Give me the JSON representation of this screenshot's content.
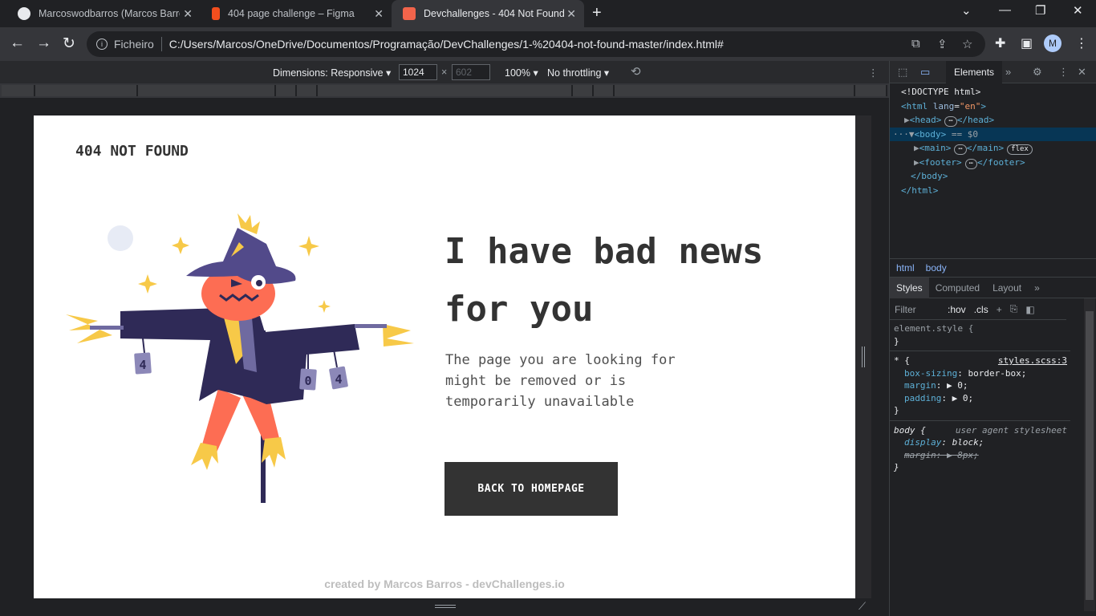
{
  "browser": {
    "tabs": [
      {
        "title": "Marcoswodbarros (Marcos Barros)",
        "color": "#e8eaed"
      },
      {
        "title": "404 page challenge – Figma",
        "color": "#f24e1e"
      },
      {
        "title": "Devchallenges - 404 Not Found",
        "color": "#f2644b"
      }
    ],
    "scheme": "Ficheiro",
    "url": "C:/Users/Marcos/OneDrive/Documentos/Programação/DevChallenges/1-%20404-not-found-master/index.html#",
    "avatar": "M"
  },
  "devicebar": {
    "dimensions": "Dimensions: Responsive ▾",
    "width": "1024",
    "height": "602",
    "zoom": "100% ▾",
    "throttling": "No throttling ▾"
  },
  "page": {
    "brand": "404 NOT FOUND",
    "headline": "I have bad news for you",
    "description": "The page you are looking for might be removed or is temporarily unavailable",
    "button": "BACK TO HOMEPAGE",
    "footer": "created by Marcos Barros - devChallenges.io",
    "cans": [
      "4",
      "0",
      "4"
    ]
  },
  "devtools": {
    "tab": "Elements",
    "dom": {
      "doctype": "<!DOCTYPE html>",
      "html_open": "<html",
      "html_attr": "lang",
      "html_val": "\"en\"",
      "head": "<head>",
      "head_close": "</head>",
      "body": "<body>",
      "body_note": "== $0",
      "main": "<main>",
      "main_close": "</main>",
      "flex": "flex",
      "footer": "<footer>",
      "footer_close": "</footer>",
      "body_close": "</body>",
      "html_close": "</html>",
      "ellipsis": "⋯"
    },
    "breadcrumbs": [
      "html",
      "body"
    ],
    "style_tabs": [
      "Styles",
      "Computed",
      "Layout"
    ],
    "filter": "Filter",
    "hov": ":hov",
    "cls": ".cls",
    "rules": {
      "element_style": "element.style {",
      "close": "}",
      "universal": "* {",
      "source": "styles.scss:3",
      "p1": "box-sizing",
      "v1": "border-box;",
      "p2": "margin",
      "v2": "▶ 0;",
      "p3": "padding",
      "v3": "▶ 0;",
      "body_sel": "body {",
      "ua": "user agent stylesheet",
      "p4": "display",
      "v4": "block;",
      "p5": "margin",
      "v5": "▶ 8px;"
    }
  },
  "colors": {
    "accent": "#333333",
    "scarecrow_hat": "#524a8a",
    "scarecrow_coat": "#2f2a57",
    "scarecrow_face": "#fd6d53",
    "straw": "#f7c948"
  }
}
